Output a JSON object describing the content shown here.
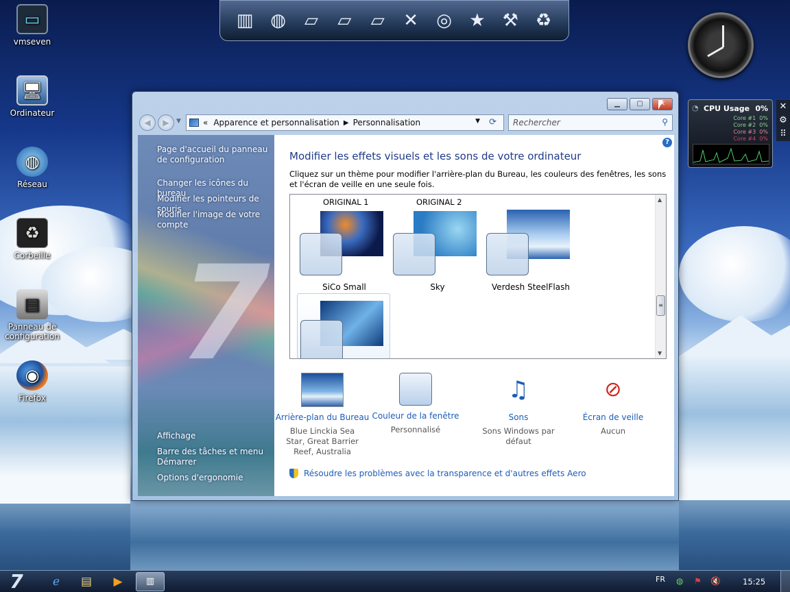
{
  "desktop": {
    "icons": [
      {
        "label": "vmseven"
      },
      {
        "label": "Ordinateur"
      },
      {
        "label": "Réseau"
      },
      {
        "label": "Corbeille"
      },
      {
        "label": "Panneau de configuration"
      },
      {
        "label": "Firefox"
      }
    ]
  },
  "dock": {
    "items": [
      "presentation-icon",
      "network-globe-icon",
      "folder-icon",
      "folder-icon",
      "folder-icon",
      "tools-icon",
      "globe-icon",
      "tshirt-icon",
      "hammer-icon",
      "recycle-bin-icon"
    ]
  },
  "gadgets": {
    "cpu": {
      "title": "CPU Usage",
      "total": "0%",
      "cores": [
        {
          "label": "Core #1",
          "value": "0%",
          "color": "#8fd18f"
        },
        {
          "label": "Core #2",
          "value": "0%",
          "color": "#8fd18f"
        },
        {
          "label": "Core #3",
          "value": "0%",
          "color": "#e08a8a"
        },
        {
          "label": "Core #4",
          "value": "0%",
          "color": "#d04060"
        }
      ]
    }
  },
  "window": {
    "address": {
      "prefix": "«",
      "crumbs": [
        "Apparence et personnalisation",
        "Personnalisation"
      ]
    },
    "search_placeholder": "Rechercher",
    "left_pane": {
      "top_links": [
        "Page d'accueil du panneau de configuration",
        "Changer les icônes du bureau",
        "Modifier les pointeurs de souris",
        "Modifier l'image de votre compte"
      ],
      "see_also": [
        "Affichage",
        "Barre des tâches et menu Démarrer",
        "Options d'ergonomie"
      ]
    },
    "content": {
      "title": "Modifier les effets visuels et les sons de votre ordinateur",
      "description": "Cliquez sur un thème pour modifier l'arrière-plan du Bureau, les couleurs des fenêtres, les sons et l'écran de veille en une seule fois.",
      "groups": [
        "ORIGINAL 1",
        "ORIGINAL 2"
      ],
      "themes": [
        {
          "name": "SiCo Small",
          "colors": [
            "#0b1a4a",
            "#3b6cc0",
            "#f08a2a"
          ]
        },
        {
          "name": "Sky",
          "colors": [
            "#2a7cc4",
            "#9ad6f2"
          ]
        },
        {
          "name": "Verdesh SteelFlash",
          "colors": [
            "#2a62b0",
            "#e8f2fb"
          ]
        },
        {
          "name": "",
          "colors": [
            "#0e3a7a",
            "#6fb2e8"
          ]
        }
      ],
      "options": [
        {
          "link": "Arrière-plan du Bureau",
          "sub": "Blue Linckia Sea Star, Great Barrier Reef, Australia"
        },
        {
          "link": "Couleur de la fenêtre",
          "sub": "Personnalisé"
        },
        {
          "link": "Sons",
          "sub": "Sons Windows par défaut"
        },
        {
          "link": "Écran de veille",
          "sub": "Aucun"
        }
      ],
      "troubleshoot_link": "Résoudre les problèmes avec la transparence et d'autres effets Aero"
    }
  },
  "taskbar": {
    "language": "FR",
    "time": "15:25"
  }
}
